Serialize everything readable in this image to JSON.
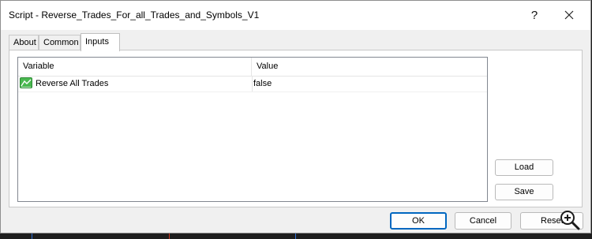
{
  "window": {
    "title": "Script - Reverse_Trades_For_all_Trades_and_Symbols_V1",
    "help_glyph": "?",
    "close_glyph": "✕"
  },
  "tabs": [
    {
      "label": "About",
      "active": false
    },
    {
      "label": "Common",
      "active": false
    },
    {
      "label": "Inputs",
      "active": true
    }
  ],
  "inputs_grid": {
    "columns": [
      "Variable",
      "Value"
    ],
    "rows": [
      {
        "icon": "parameter-icon",
        "variable": "Reverse All Trades",
        "value": "false"
      }
    ]
  },
  "side_buttons": {
    "load": "Load",
    "save": "Save"
  },
  "footer_buttons": {
    "ok": "OK",
    "cancel": "Cancel",
    "reset": "Reset"
  },
  "icons": {
    "help": "help-icon",
    "close": "close-icon",
    "zoom": "zoom-in-icon"
  },
  "colors": {
    "accent": "#0067c0",
    "icon_green": "#3cb44a",
    "background_chart": "#1e1e1e"
  }
}
